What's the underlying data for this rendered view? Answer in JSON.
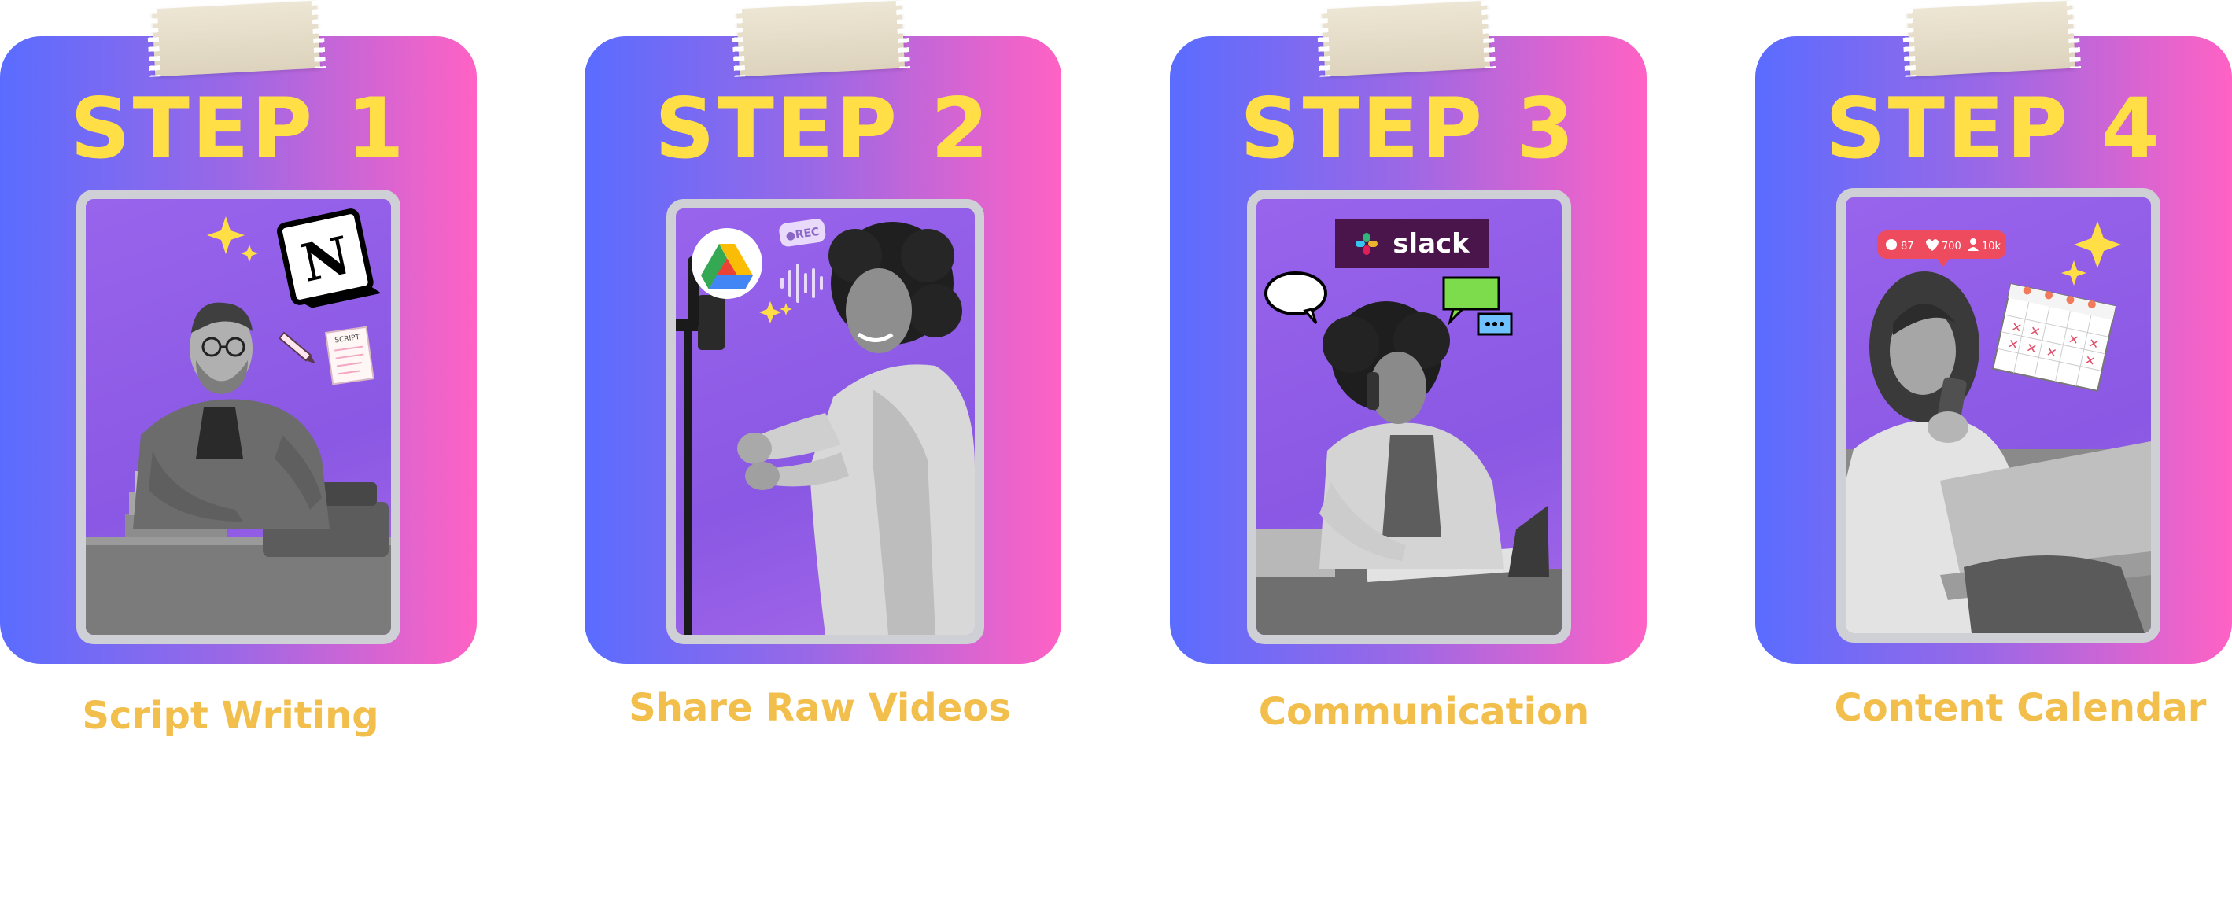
{
  "colors": {
    "card_gradient_start": "#5a6cff",
    "card_gradient_end": "#ff62c4",
    "step_title": "#ffdf45",
    "caption": "#f2bf4d"
  },
  "steps": [
    {
      "title": "STEP 1",
      "caption": "Script Writing",
      "badge_letter": "N",
      "note_text": "SCRIPT"
    },
    {
      "title": "STEP 2",
      "caption": "Share Raw Videos",
      "rec_label": "●REC"
    },
    {
      "title": "STEP 3",
      "caption": "Communication",
      "slack_label": "slack"
    },
    {
      "title": "STEP 4",
      "caption": "Content Calendar",
      "stats": {
        "comments": "87",
        "likes": "700",
        "followers": "10k"
      }
    }
  ]
}
